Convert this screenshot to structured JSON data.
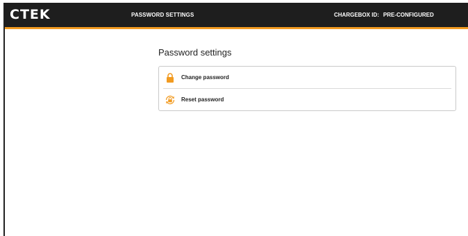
{
  "header": {
    "logo_text": "CTEK",
    "page_title": "PASSWORD SETTINGS",
    "chargebox_label": "CHARGEBOX ID:",
    "chargebox_value": "PRE-CONFIGURED"
  },
  "main": {
    "title": "Password settings",
    "items": [
      {
        "label": "Change password",
        "icon": "lock-icon"
      },
      {
        "label": "Reset password",
        "icon": "lock-reset-icon"
      }
    ]
  },
  "colors": {
    "accent": "#f29b21",
    "header_bg": "#1e1e1e"
  }
}
